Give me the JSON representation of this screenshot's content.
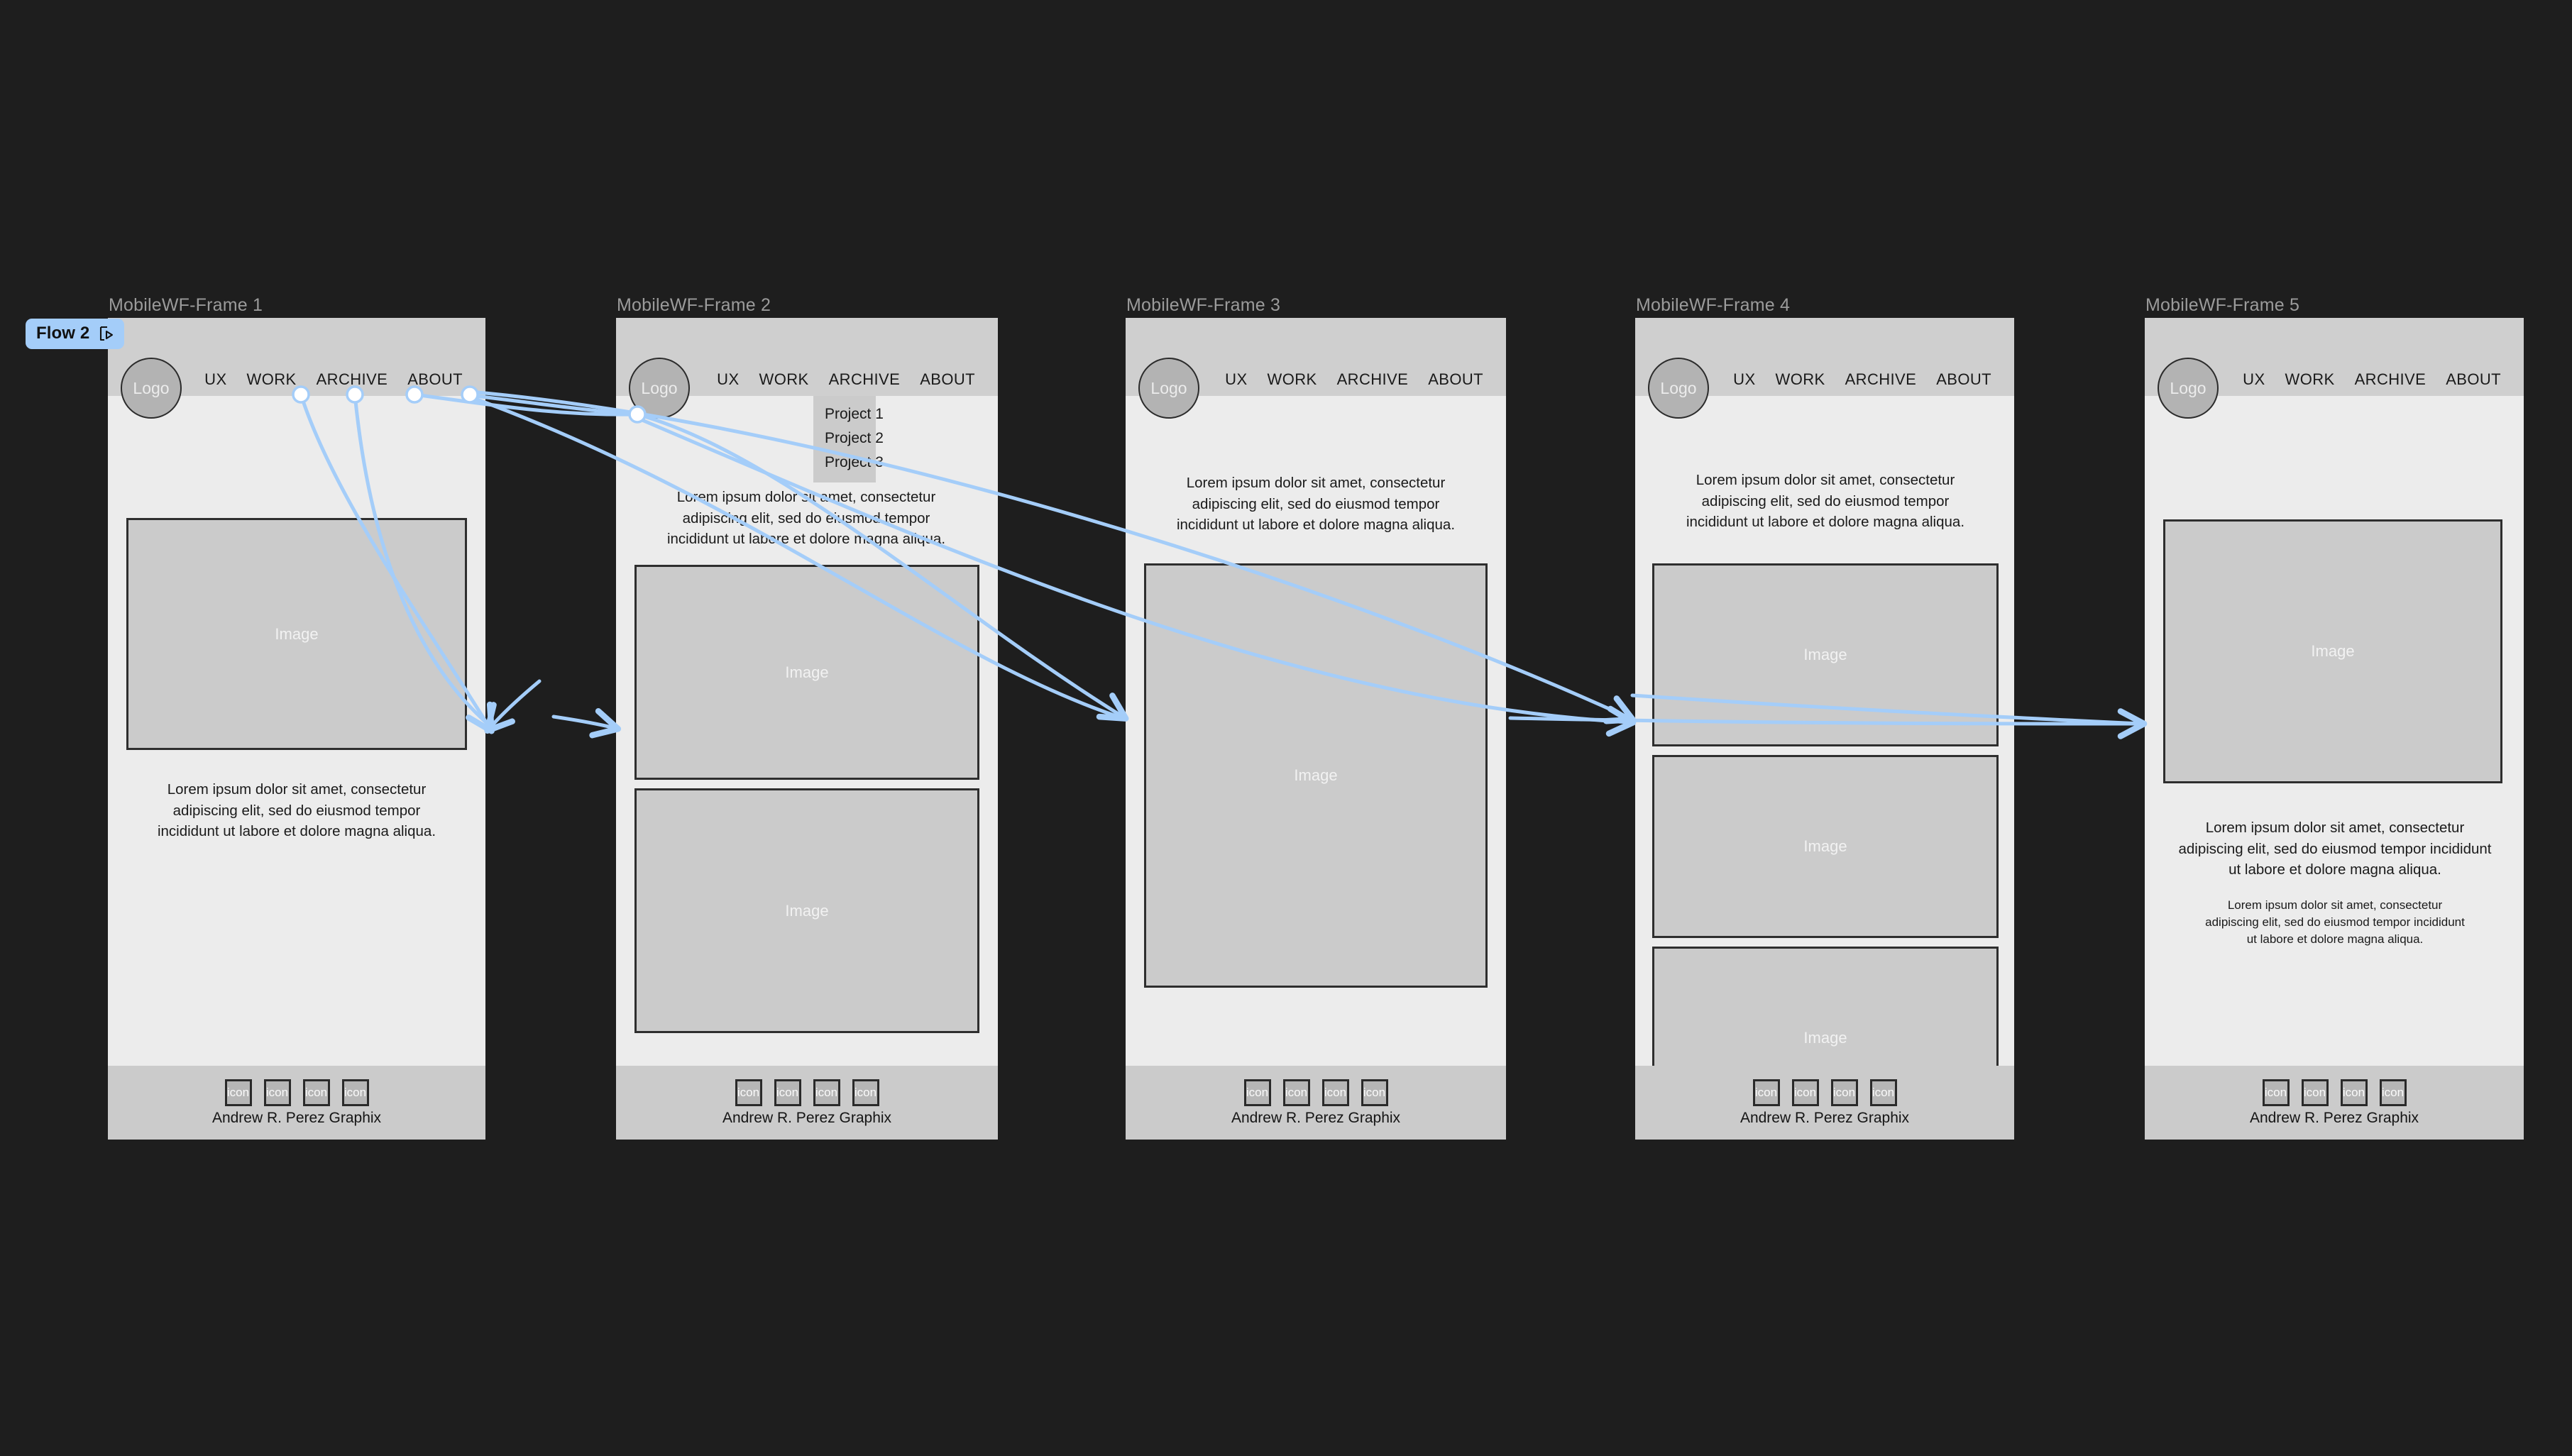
{
  "canvas": {
    "background": "#1E1E1E",
    "connector_color": "#A4CDF9"
  },
  "flow": {
    "label": "Flow 2",
    "icon": "present-play-icon"
  },
  "nav_items": [
    "UX",
    "WORK",
    "ARCHIVE",
    "ABOUT"
  ],
  "logo_label": "Logo",
  "image_label": "Image",
  "footer": {
    "icon_label": "icon",
    "icon_count": 4,
    "credit": "Andrew R. Perez Graphix"
  },
  "lorem": "Lorem ipsum dolor sit amet, consectetur adipiscing elit, sed do eiusmod tempor incididunt ut labore et dolore magna aliqua.",
  "dropdown_items": [
    "Project 1",
    "Project 2",
    "Project 3"
  ],
  "frames": [
    {
      "label": "MobileWF-Frame 1",
      "has_dropdown": false,
      "has_nav_hotspots": true,
      "has_logo_hotspot": false
    },
    {
      "label": "MobileWF-Frame 2",
      "has_dropdown": true,
      "has_nav_hotspots": false,
      "has_logo_hotspot": true
    },
    {
      "label": "MobileWF-Frame 3",
      "has_dropdown": false,
      "has_nav_hotspots": false,
      "has_logo_hotspot": false
    },
    {
      "label": "MobileWF-Frame 4",
      "has_dropdown": false,
      "has_nav_hotspots": false,
      "has_logo_hotspot": false
    },
    {
      "label": "MobileWF-Frame 5",
      "has_dropdown": false,
      "has_nav_hotspots": false,
      "has_logo_hotspot": false
    }
  ]
}
